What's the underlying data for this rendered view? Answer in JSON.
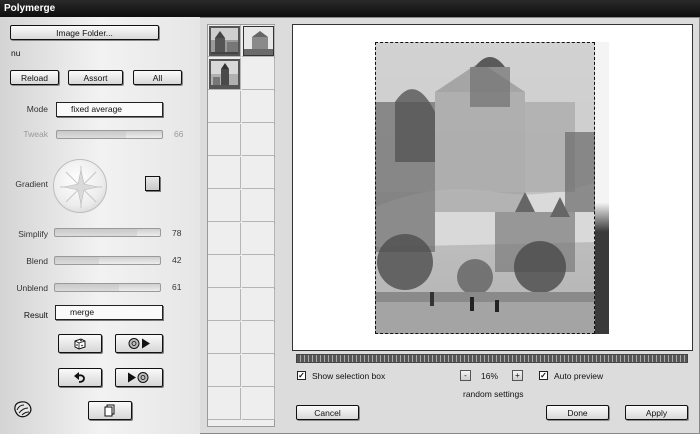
{
  "window": {
    "title": "Polymerge"
  },
  "left": {
    "image_folder_label": "Image Folder...",
    "folder_name": "nu",
    "reload_label": "Reload",
    "assort_label": "Assort",
    "all_label": "All",
    "mode": {
      "label": "Mode",
      "value": "fixed average"
    },
    "tweak": {
      "label": "Tweak",
      "value": "66",
      "level": 66
    },
    "gradient": {
      "label": "Gradient"
    },
    "simplify": {
      "label": "Simplify",
      "value": "78",
      "level": 78
    },
    "blend": {
      "label": "Blend",
      "value": "42",
      "level": 42
    },
    "unblend": {
      "label": "Unblend",
      "value": "61",
      "level": 61
    },
    "result": {
      "label": "Result",
      "value": "merge"
    }
  },
  "preview": {
    "show_selection_label": "Show selection box",
    "show_selection_checked": "✓",
    "zoom_decrease": "-",
    "zoom_value": "16%",
    "zoom_increase": "+",
    "auto_preview_label": "Auto preview",
    "auto_preview_checked": "✓",
    "random_settings_label": "random settings"
  },
  "footer": {
    "cancel_label": "Cancel",
    "done_label": "Done",
    "apply_label": "Apply"
  },
  "icons": {
    "app_logo": "paw-icon",
    "dice": "dice-icon",
    "play_random": "random-forward-icon",
    "undo": "undo-arrow-icon",
    "step_forward": "forward-random-icon",
    "copy": "copy-page-icon"
  }
}
